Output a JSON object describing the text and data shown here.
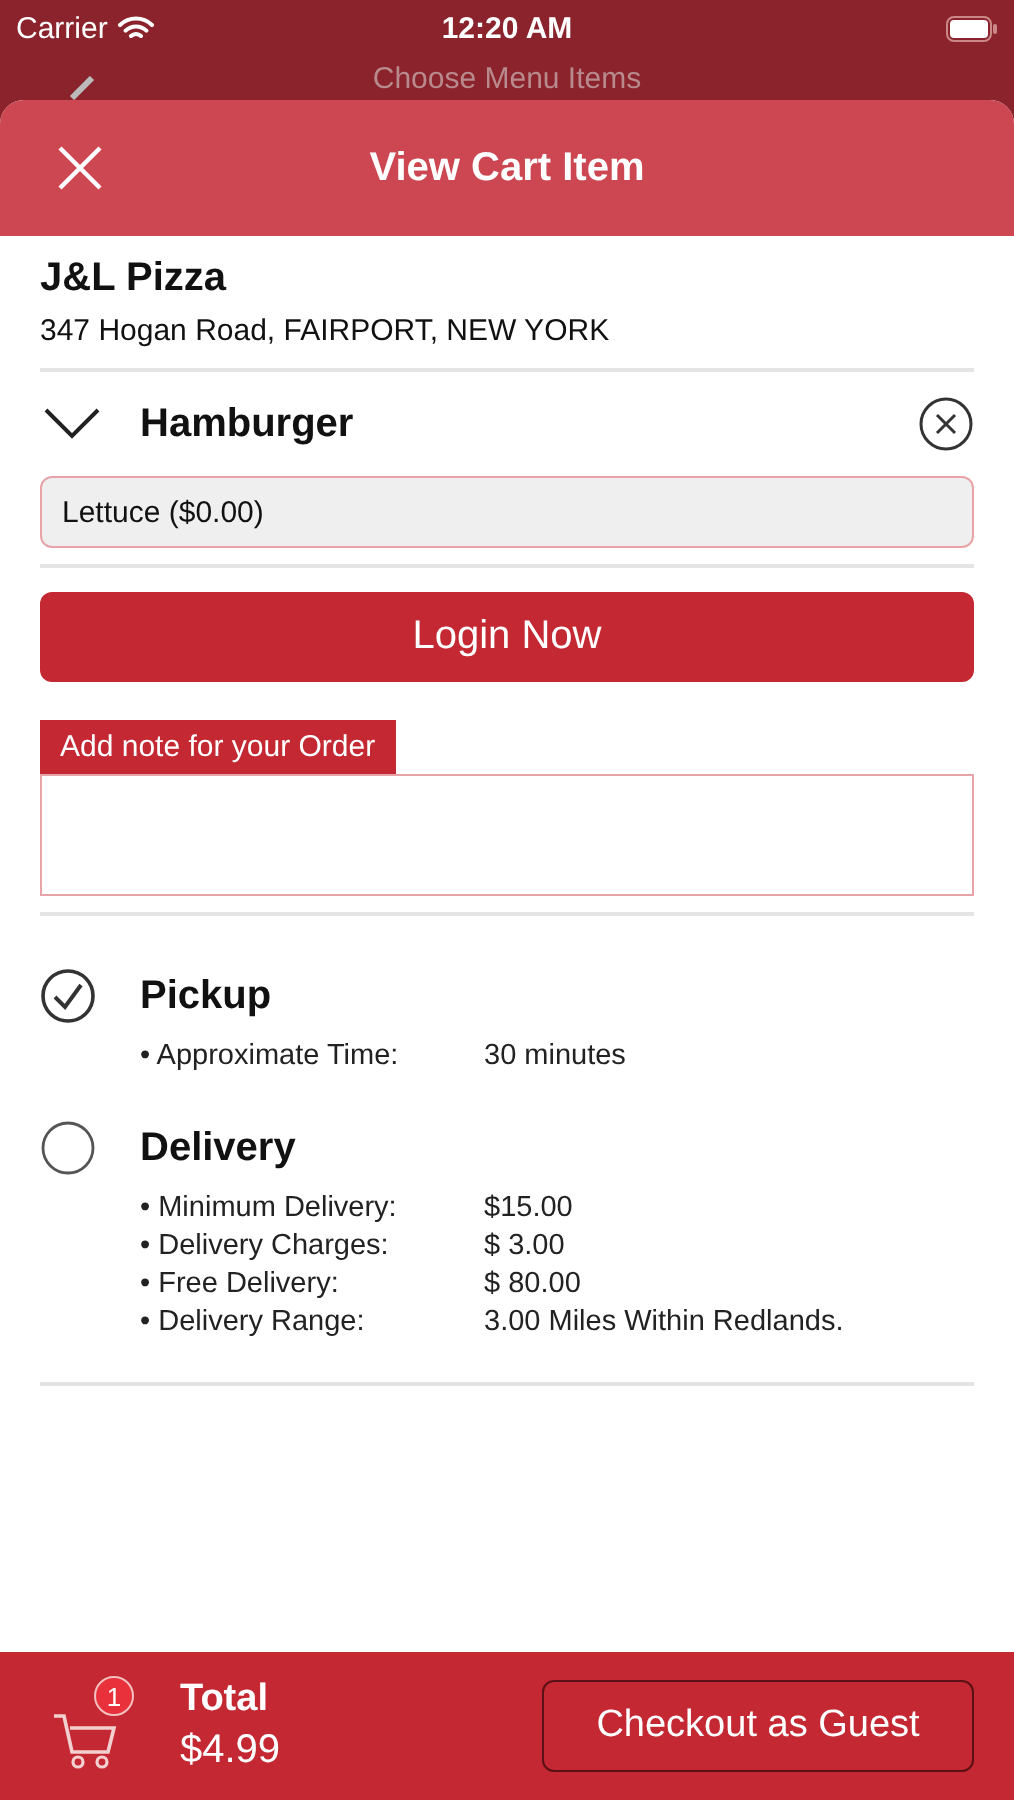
{
  "status_bar": {
    "carrier": "Carrier",
    "time": "12:20 AM"
  },
  "background_nav": {
    "title": "Choose Menu Items"
  },
  "sheet": {
    "title": "View Cart Item"
  },
  "restaurant": {
    "name": "J&L Pizza",
    "address": "347 Hogan Road, FAIRPORT, NEW YORK"
  },
  "item": {
    "name": "Hamburger",
    "expanded": true,
    "options": [
      "Lettuce ($0.00)"
    ]
  },
  "login_button": "Login Now",
  "note": {
    "label": "Add note for your Order"
  },
  "order_types": [
    {
      "name": "Pickup",
      "selected": true,
      "details": [
        {
          "label": "• Approximate Time:",
          "value": "30 minutes"
        }
      ]
    },
    {
      "name": "Delivery",
      "selected": false,
      "details": [
        {
          "label": "• Minimum Delivery:",
          "value": "$15.00"
        },
        {
          "label": "• Delivery Charges:",
          "value": "$ 3.00"
        },
        {
          "label": "• Free Delivery:",
          "value": "$ 80.00"
        },
        {
          "label": "• Delivery Range:",
          "value": "3.00 Miles Within Redlands."
        }
      ]
    }
  ],
  "footer": {
    "cart_count": "1",
    "total_label": "Total",
    "total": "$4.99",
    "checkout_button": "Checkout as Guest"
  }
}
